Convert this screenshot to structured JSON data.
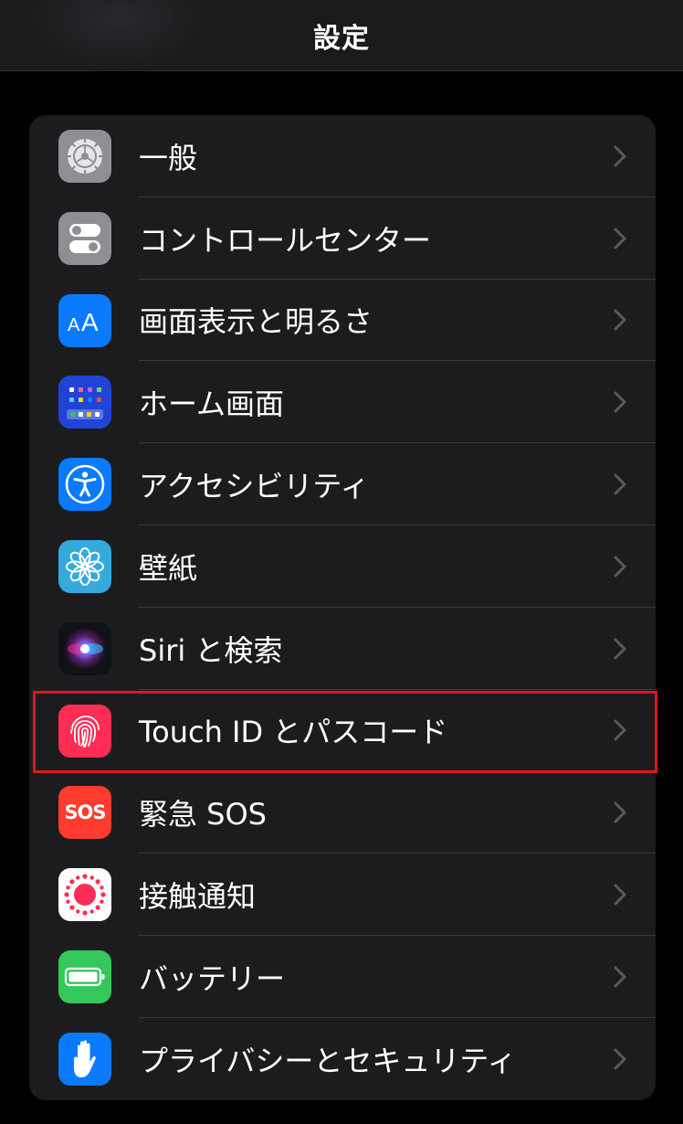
{
  "header": {
    "title": "設定"
  },
  "items": [
    {
      "label": "一般",
      "icon": "gear-icon",
      "color": "#8e8e93"
    },
    {
      "label": "コントロールセンター",
      "icon": "toggle-switches-icon",
      "color": "#8e8e93"
    },
    {
      "label": "画面表示と明るさ",
      "icon": "text-size-aa-icon",
      "color": "#0a7aff"
    },
    {
      "label": "ホーム画面",
      "icon": "home-screen-grid-icon",
      "color": "#2143d6"
    },
    {
      "label": "アクセシビリティ",
      "icon": "accessibility-person-icon",
      "color": "#0a7aff"
    },
    {
      "label": "壁紙",
      "icon": "flower-icon",
      "color": "#34aadc"
    },
    {
      "label": "Siri と検索",
      "icon": "siri-orb-icon",
      "color": "#1a1a2e"
    },
    {
      "label": "Touch ID とパスコード",
      "icon": "fingerprint-icon",
      "color": "#ff2d55"
    },
    {
      "label": "緊急 SOS",
      "icon": "sos-icon",
      "color": "#ff3b30",
      "icon_text": "SOS"
    },
    {
      "label": "接触通知",
      "icon": "exposure-notification-icon",
      "color": "#ffffff"
    },
    {
      "label": "バッテリー",
      "icon": "battery-icon",
      "color": "#34c759"
    },
    {
      "label": "プライバシーとセキュリティ",
      "icon": "hand-icon",
      "color": "#0a7aff"
    }
  ],
  "highlighted_item": "Touch ID とパスコード",
  "colors": {
    "background": "#000000",
    "group_background": "#1c1c1e",
    "separator": "#38383a",
    "highlight": "#e0141e",
    "chevron": "#5a5a5e"
  }
}
